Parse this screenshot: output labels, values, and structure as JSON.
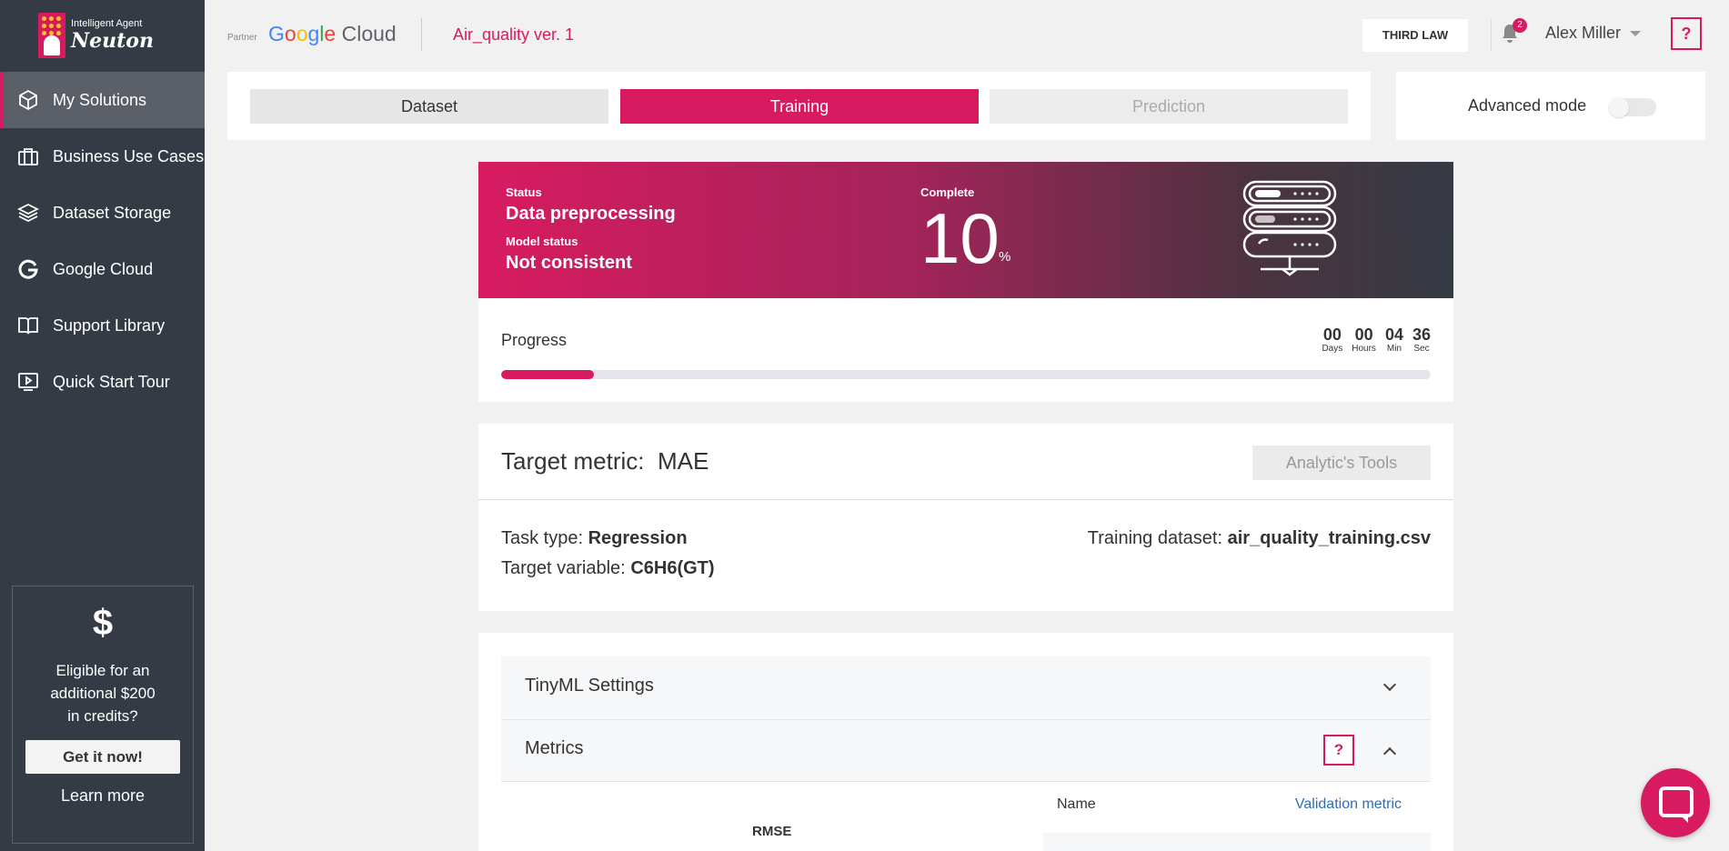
{
  "brand": {
    "sub": "Intelligent Agent",
    "name": "Neuton",
    "accent": "#d81b60"
  },
  "sidebar": {
    "items": [
      {
        "label": "My Solutions",
        "icon": "cube-icon"
      },
      {
        "label": "Business Use Cases",
        "icon": "briefcase-icon"
      },
      {
        "label": "Dataset Storage",
        "icon": "layers-icon"
      },
      {
        "label": "Google Cloud",
        "icon": "google-g-icon"
      },
      {
        "label": "Support Library",
        "icon": "book-icon"
      },
      {
        "label": "Quick Start Tour",
        "icon": "play-screen-icon"
      }
    ],
    "promo": {
      "icon": "dollar-icon",
      "line1": "Eligible for an",
      "line2": "additional $200",
      "line3": "in credits?",
      "button": "Get it now!",
      "link": "Learn more"
    }
  },
  "header": {
    "partner": "Partner",
    "cloud_word": "Cloud",
    "project": "Air_quality ver. 1",
    "third_law": "THIRD LAW",
    "notifications": "2",
    "user": "Alex Miller",
    "help": "?"
  },
  "stages": {
    "tabs": [
      "Dataset",
      "Training",
      "Prediction"
    ],
    "active": "Training"
  },
  "advanced": {
    "label": "Advanced mode",
    "enabled": false
  },
  "status": {
    "status_label": "Status",
    "status_value": "Data preprocessing",
    "model_label": "Model status",
    "model_value": "Not consistent",
    "complete_label": "Complete",
    "complete_value": "10",
    "complete_unit": "%"
  },
  "progress": {
    "label": "Progress",
    "fraction": 0.1,
    "timer": [
      {
        "num": "00",
        "unit": "Days"
      },
      {
        "num": "00",
        "unit": "Hours"
      },
      {
        "num": "04",
        "unit": "Min"
      },
      {
        "num": "36",
        "unit": "Sec"
      }
    ]
  },
  "target": {
    "title": "Target metric:",
    "metric": "MAE",
    "tools": "Analytic's Tools",
    "task_label": "Task type:",
    "task_value": "Regression",
    "var_label": "Target variable:",
    "var_value": "C6H6(GT)",
    "dataset_label": "Training dataset:",
    "dataset_value": "air_quality_training.csv"
  },
  "settings": {
    "tinyml": "TinyML Settings",
    "metrics": "Metrics",
    "help": "?",
    "name_header": "Name",
    "validation_header": "Validation metric",
    "first_metric": "RMSE"
  }
}
